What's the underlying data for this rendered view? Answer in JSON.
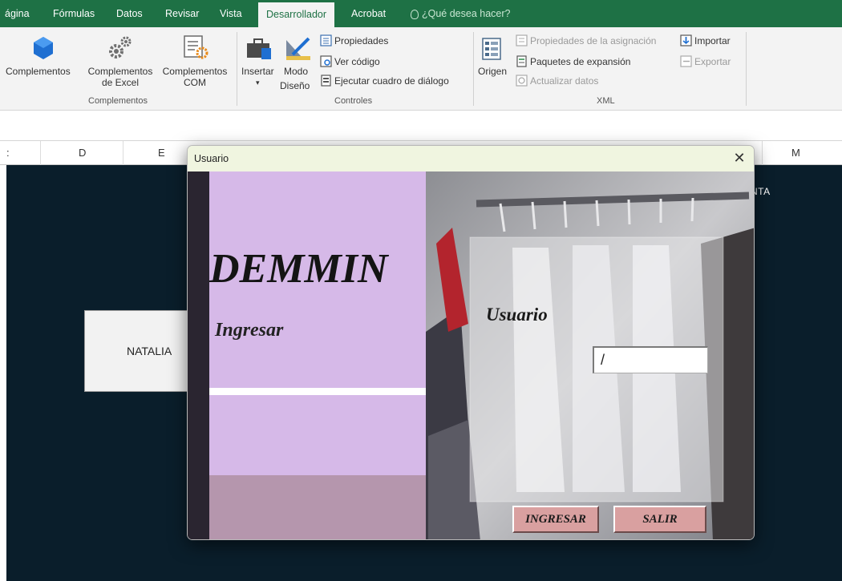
{
  "ribbon": {
    "tabs": [
      "ágina",
      "Fórmulas",
      "Datos",
      "Revisar",
      "Vista",
      "Desarrollador",
      "Acrobat"
    ],
    "active_tab": "Desarrollador",
    "tell_me": "¿Qué desea hacer?",
    "complementos": {
      "btn1": "Complementos",
      "btn2_line1": "Complementos",
      "btn2_line2": "de Excel",
      "btn3_line1": "Complementos",
      "btn3_line2": "COM",
      "group_label": "Complementos"
    },
    "controles": {
      "insertar": "Insertar",
      "modo_line1": "Modo",
      "modo_line2": "Diseño",
      "propiedades": "Propiedades",
      "ver_codigo": "Ver código",
      "ejecutar": "Ejecutar cuadro de diálogo",
      "group_label": "Controles"
    },
    "xml": {
      "origen": "Origen",
      "propiedades_asignacion": "Propiedades de la asignación",
      "paquetes": "Paquetes de expansión",
      "actualizar": "Actualizar datos",
      "importar": "Importar",
      "exportar": "Exportar",
      "group_label": "XML"
    }
  },
  "sheet": {
    "columns": [
      ":",
      "D",
      "E",
      "M"
    ],
    "cell_text": "NATALIA",
    "bg_label": "NTA"
  },
  "dialog": {
    "title": "Usuario",
    "close_glyph": "✕",
    "brand": "DEMMIN",
    "ingresar_label": "Ingresar",
    "usuario_label": "Usuario",
    "input_value": "/",
    "btn_ingresar": "INGRESAR",
    "btn_salir": "SALIR"
  },
  "colors": {
    "excel_green": "#1e7145",
    "sheet_bg": "#0a1e2b",
    "lavender": "#d6b9e8",
    "mauve": "#b596ad",
    "button_pink": "#d9a0a0"
  }
}
